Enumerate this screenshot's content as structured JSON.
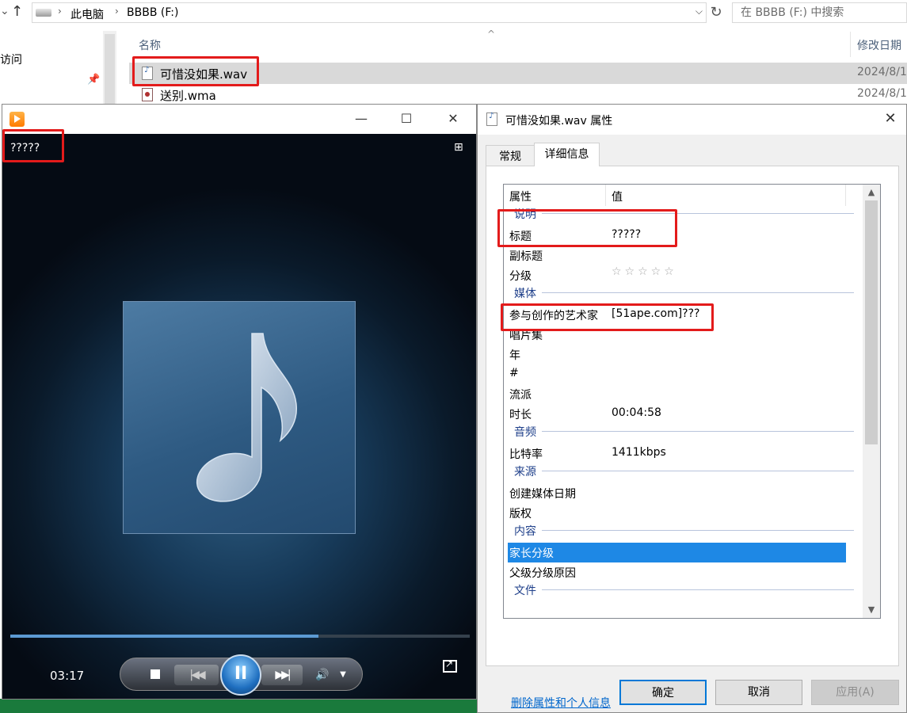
{
  "explorer": {
    "breadcrumb": [
      "此电脑",
      "BBBB (F:)"
    ],
    "search_placeholder": "在 BBBB (F:) 中搜索",
    "nav_text": "访问",
    "columns": {
      "name": "名称",
      "date": "修改日期"
    },
    "files": [
      {
        "name": "可惜没如果.wav",
        "date": "2024/8/1",
        "type": "wav",
        "selected": true
      },
      {
        "name": "送别.wma",
        "date": "2024/8/1",
        "type": "wma",
        "selected": false
      }
    ]
  },
  "player": {
    "title": "?????",
    "elapsed": "03:17",
    "progress_fraction": 0.67,
    "controls": {
      "pause_glyph": "II"
    }
  },
  "properties": {
    "title": "可惜没如果.wav 属性",
    "tabs": [
      "常规",
      "详细信息"
    ],
    "header": {
      "property": "属性",
      "value": "值"
    },
    "rows": [
      {
        "kind": "group",
        "name": "说明"
      },
      {
        "kind": "item",
        "name": "标题",
        "value": "?????"
      },
      {
        "kind": "item",
        "name": "副标题",
        "value": ""
      },
      {
        "kind": "stars",
        "name": "分级",
        "value": "☆☆☆☆☆"
      },
      {
        "kind": "group",
        "name": "媒体"
      },
      {
        "kind": "item",
        "name": "参与创作的艺术家",
        "value": "[51ape.com]???"
      },
      {
        "kind": "item",
        "name": "唱片集",
        "value": ""
      },
      {
        "kind": "item",
        "name": "年",
        "value": ""
      },
      {
        "kind": "item",
        "name": "#",
        "value": ""
      },
      {
        "kind": "item",
        "name": "流派",
        "value": ""
      },
      {
        "kind": "item",
        "name": "时长",
        "value": "00:04:58"
      },
      {
        "kind": "group",
        "name": "音频"
      },
      {
        "kind": "item",
        "name": "比特率",
        "value": "1411kbps"
      },
      {
        "kind": "group",
        "name": "来源"
      },
      {
        "kind": "item",
        "name": "创建媒体日期",
        "value": ""
      },
      {
        "kind": "item",
        "name": "版权",
        "value": ""
      },
      {
        "kind": "group",
        "name": "内容"
      },
      {
        "kind": "highlight",
        "name": "家长分级",
        "value": ""
      },
      {
        "kind": "item",
        "name": "父级分级原因",
        "value": ""
      },
      {
        "kind": "group",
        "name": "文件"
      }
    ],
    "remove_link": "删除属性和个人信息",
    "buttons": {
      "ok": "确定",
      "cancel": "取消",
      "apply": "应用(A)"
    }
  },
  "colors": {
    "annotation_red": "#e31b1b",
    "selection_blue": "#1e88e5",
    "link_blue": "#0066cc"
  }
}
